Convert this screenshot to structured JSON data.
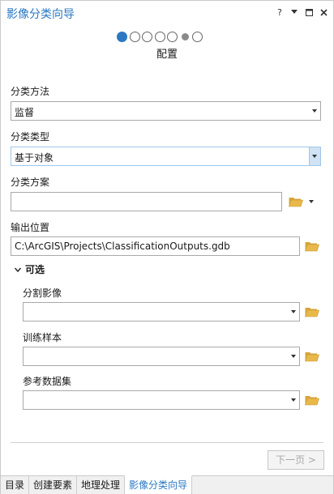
{
  "window": {
    "title": "影像分类向导",
    "help_label": "?",
    "icons": [
      "menu-dropdown-icon",
      "maximize-icon",
      "close-icon"
    ]
  },
  "wizard": {
    "steps_total": 7,
    "current_step": 1,
    "step_title": "配置"
  },
  "form": {
    "classification_method_label": "分类方法",
    "classification_method_value": "监督",
    "classification_type_label": "分类类型",
    "classification_type_value": "基于对象",
    "classification_schema_label": "分类方案",
    "classification_schema_value": "",
    "output_location_label": "输出位置",
    "output_location_value": "C:\\ArcGIS\\Projects\\ClassificationOutputs.gdb"
  },
  "optional": {
    "section_label": "可选",
    "segmented_image_label": "分割影像",
    "segmented_image_value": "",
    "training_samples_label": "训练样本",
    "training_samples_value": "",
    "reference_dataset_label": "参考数据集",
    "reference_dataset_value": ""
  },
  "footer": {
    "next_label": "下一页 >"
  },
  "tabs": [
    {
      "label": "目录",
      "active": false
    },
    {
      "label": "创建要素",
      "active": false
    },
    {
      "label": "地理处理",
      "active": false
    },
    {
      "label": "影像分类向导",
      "active": true
    }
  ],
  "colors": {
    "accent": "#2b78c2",
    "folder": "#e8b94a",
    "combo_highlight": "#cfe3f5"
  }
}
